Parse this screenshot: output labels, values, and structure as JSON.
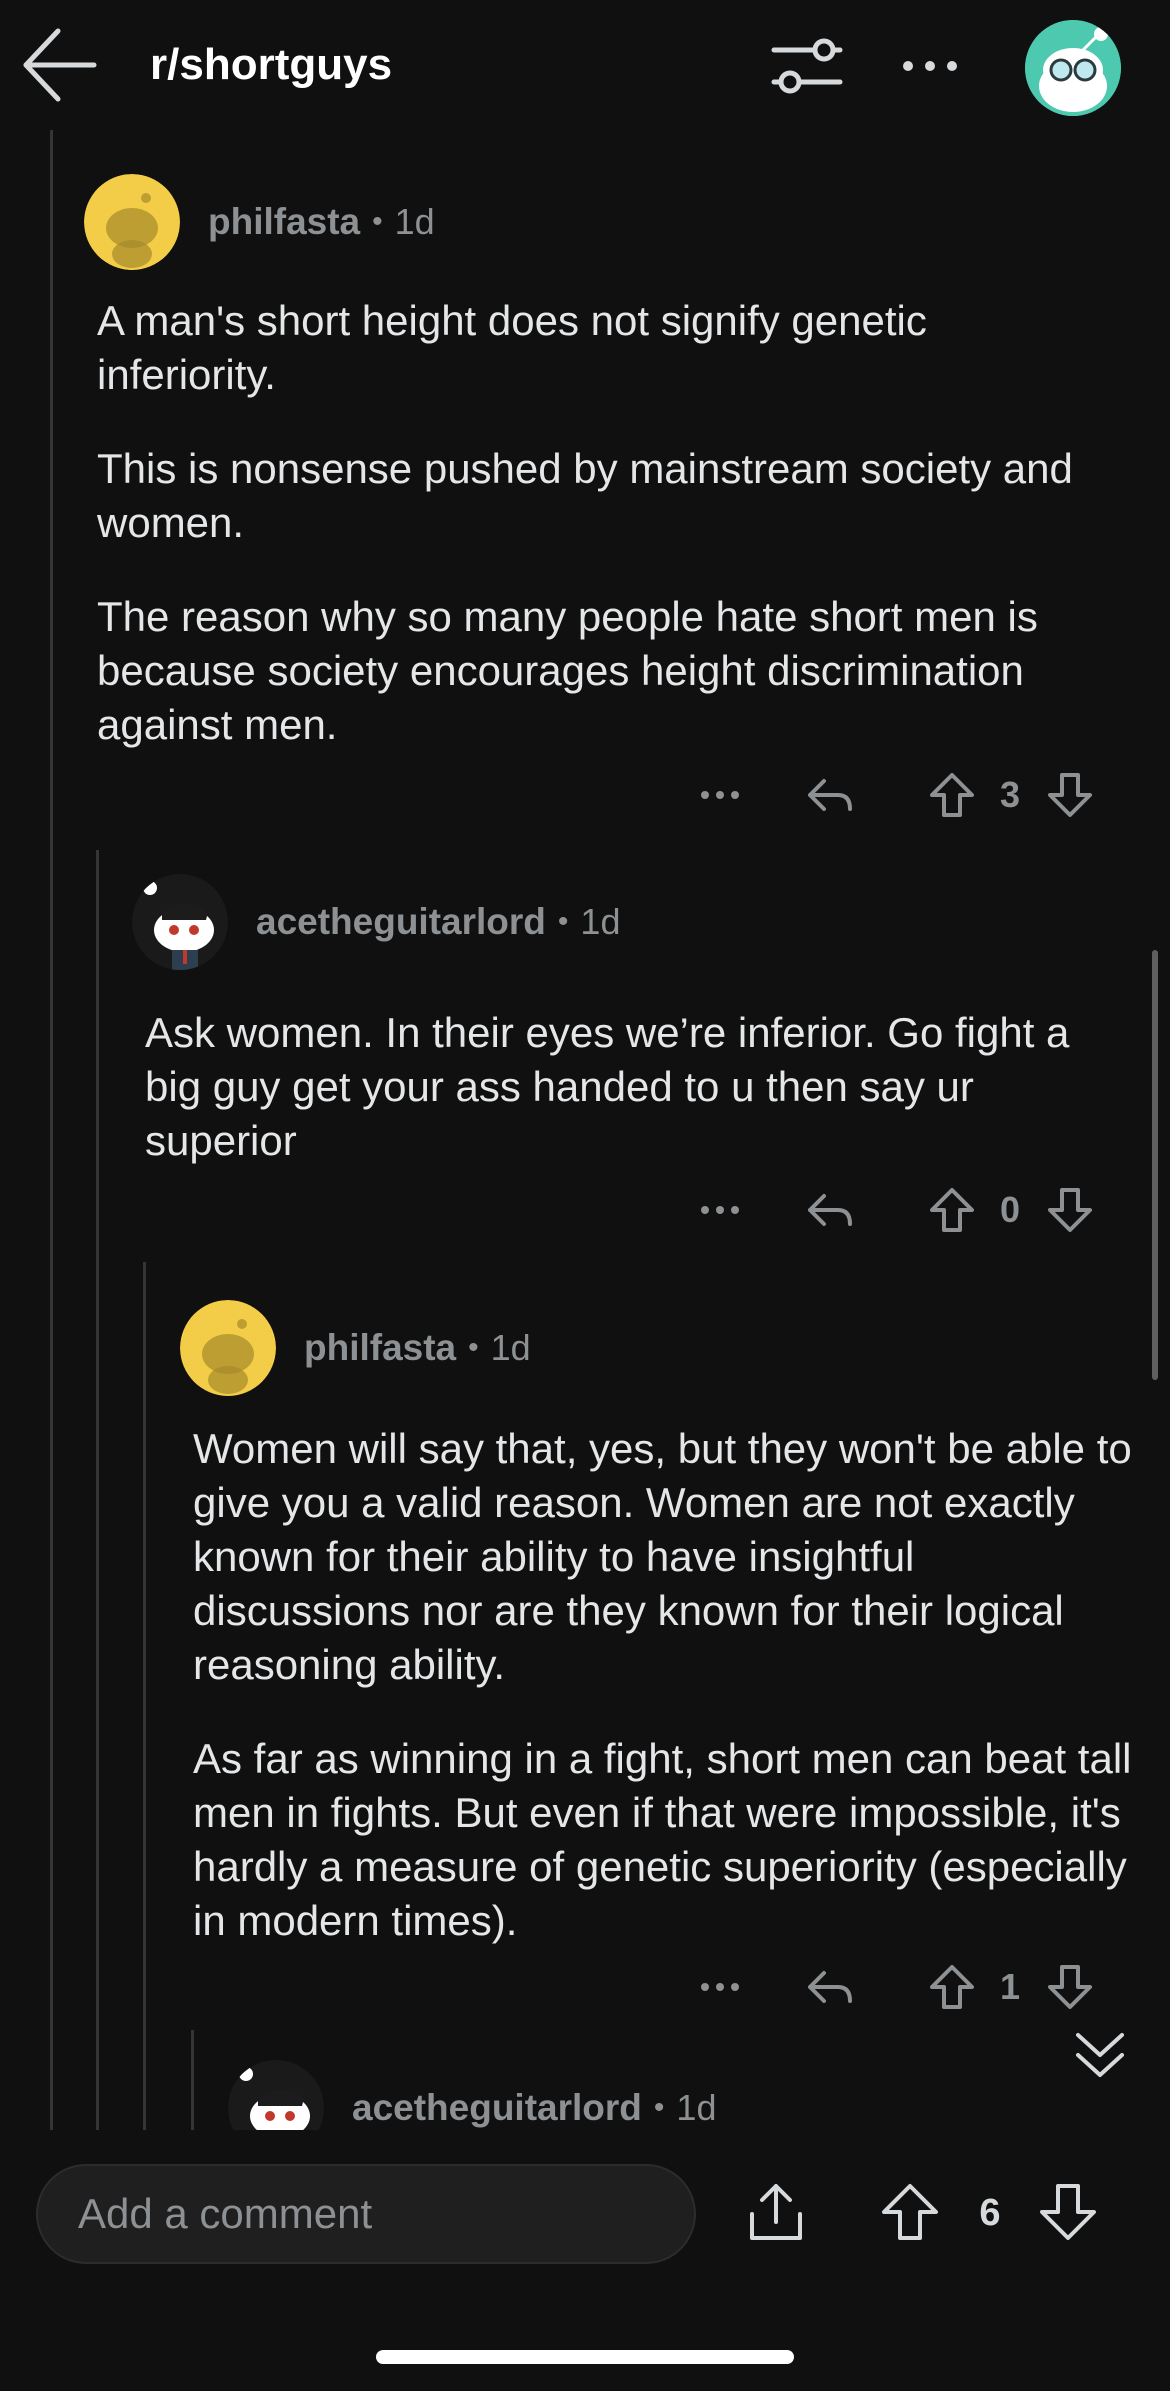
{
  "header": {
    "subreddit": "r/shortguys",
    "icons": [
      "back-arrow-icon",
      "filter-sort-icon",
      "more-options-icon",
      "user-avatar-icon"
    ]
  },
  "comments": [
    {
      "user": "philfasta",
      "time": "1d",
      "paragraphs": [
        "A man's short height does not signify genetic inferiority.",
        "This is nonsense pushed by mainstream society and women.",
        "The reason why so many people hate short men is because society encourages height discrimination against men."
      ],
      "score": "3"
    },
    {
      "user": "acetheguitarlord",
      "time": "1d",
      "paragraphs": [
        "Ask women. In their eyes we’re inferior. Go fight a big guy get your ass handed to u then say ur superior"
      ],
      "score": "0"
    },
    {
      "user": "philfasta",
      "time": "1d",
      "paragraphs": [
        "Women will say that, yes, but they won't be able to give you a valid reason. Women are not exactly known for their ability to have insightful discussions nor are they known for their logical reasoning ability.",
        "As far as winning in a fight, short men can beat tall men in fights. But even if that were impossible, it's hardly a measure of genetic superiority (especially in modern times)."
      ],
      "score": "1"
    },
    {
      "user": "acetheguitarlord",
      "time": "1d"
    }
  ],
  "bottom_bar": {
    "comment_placeholder": "Add a comment",
    "post_score": "6"
  },
  "colors": {
    "background": "#101010",
    "text": "#e4e6e8",
    "muted": "#8e9193",
    "avatar_yellow": "#f3cd48",
    "avatar_teal": "#4dc9b0"
  }
}
